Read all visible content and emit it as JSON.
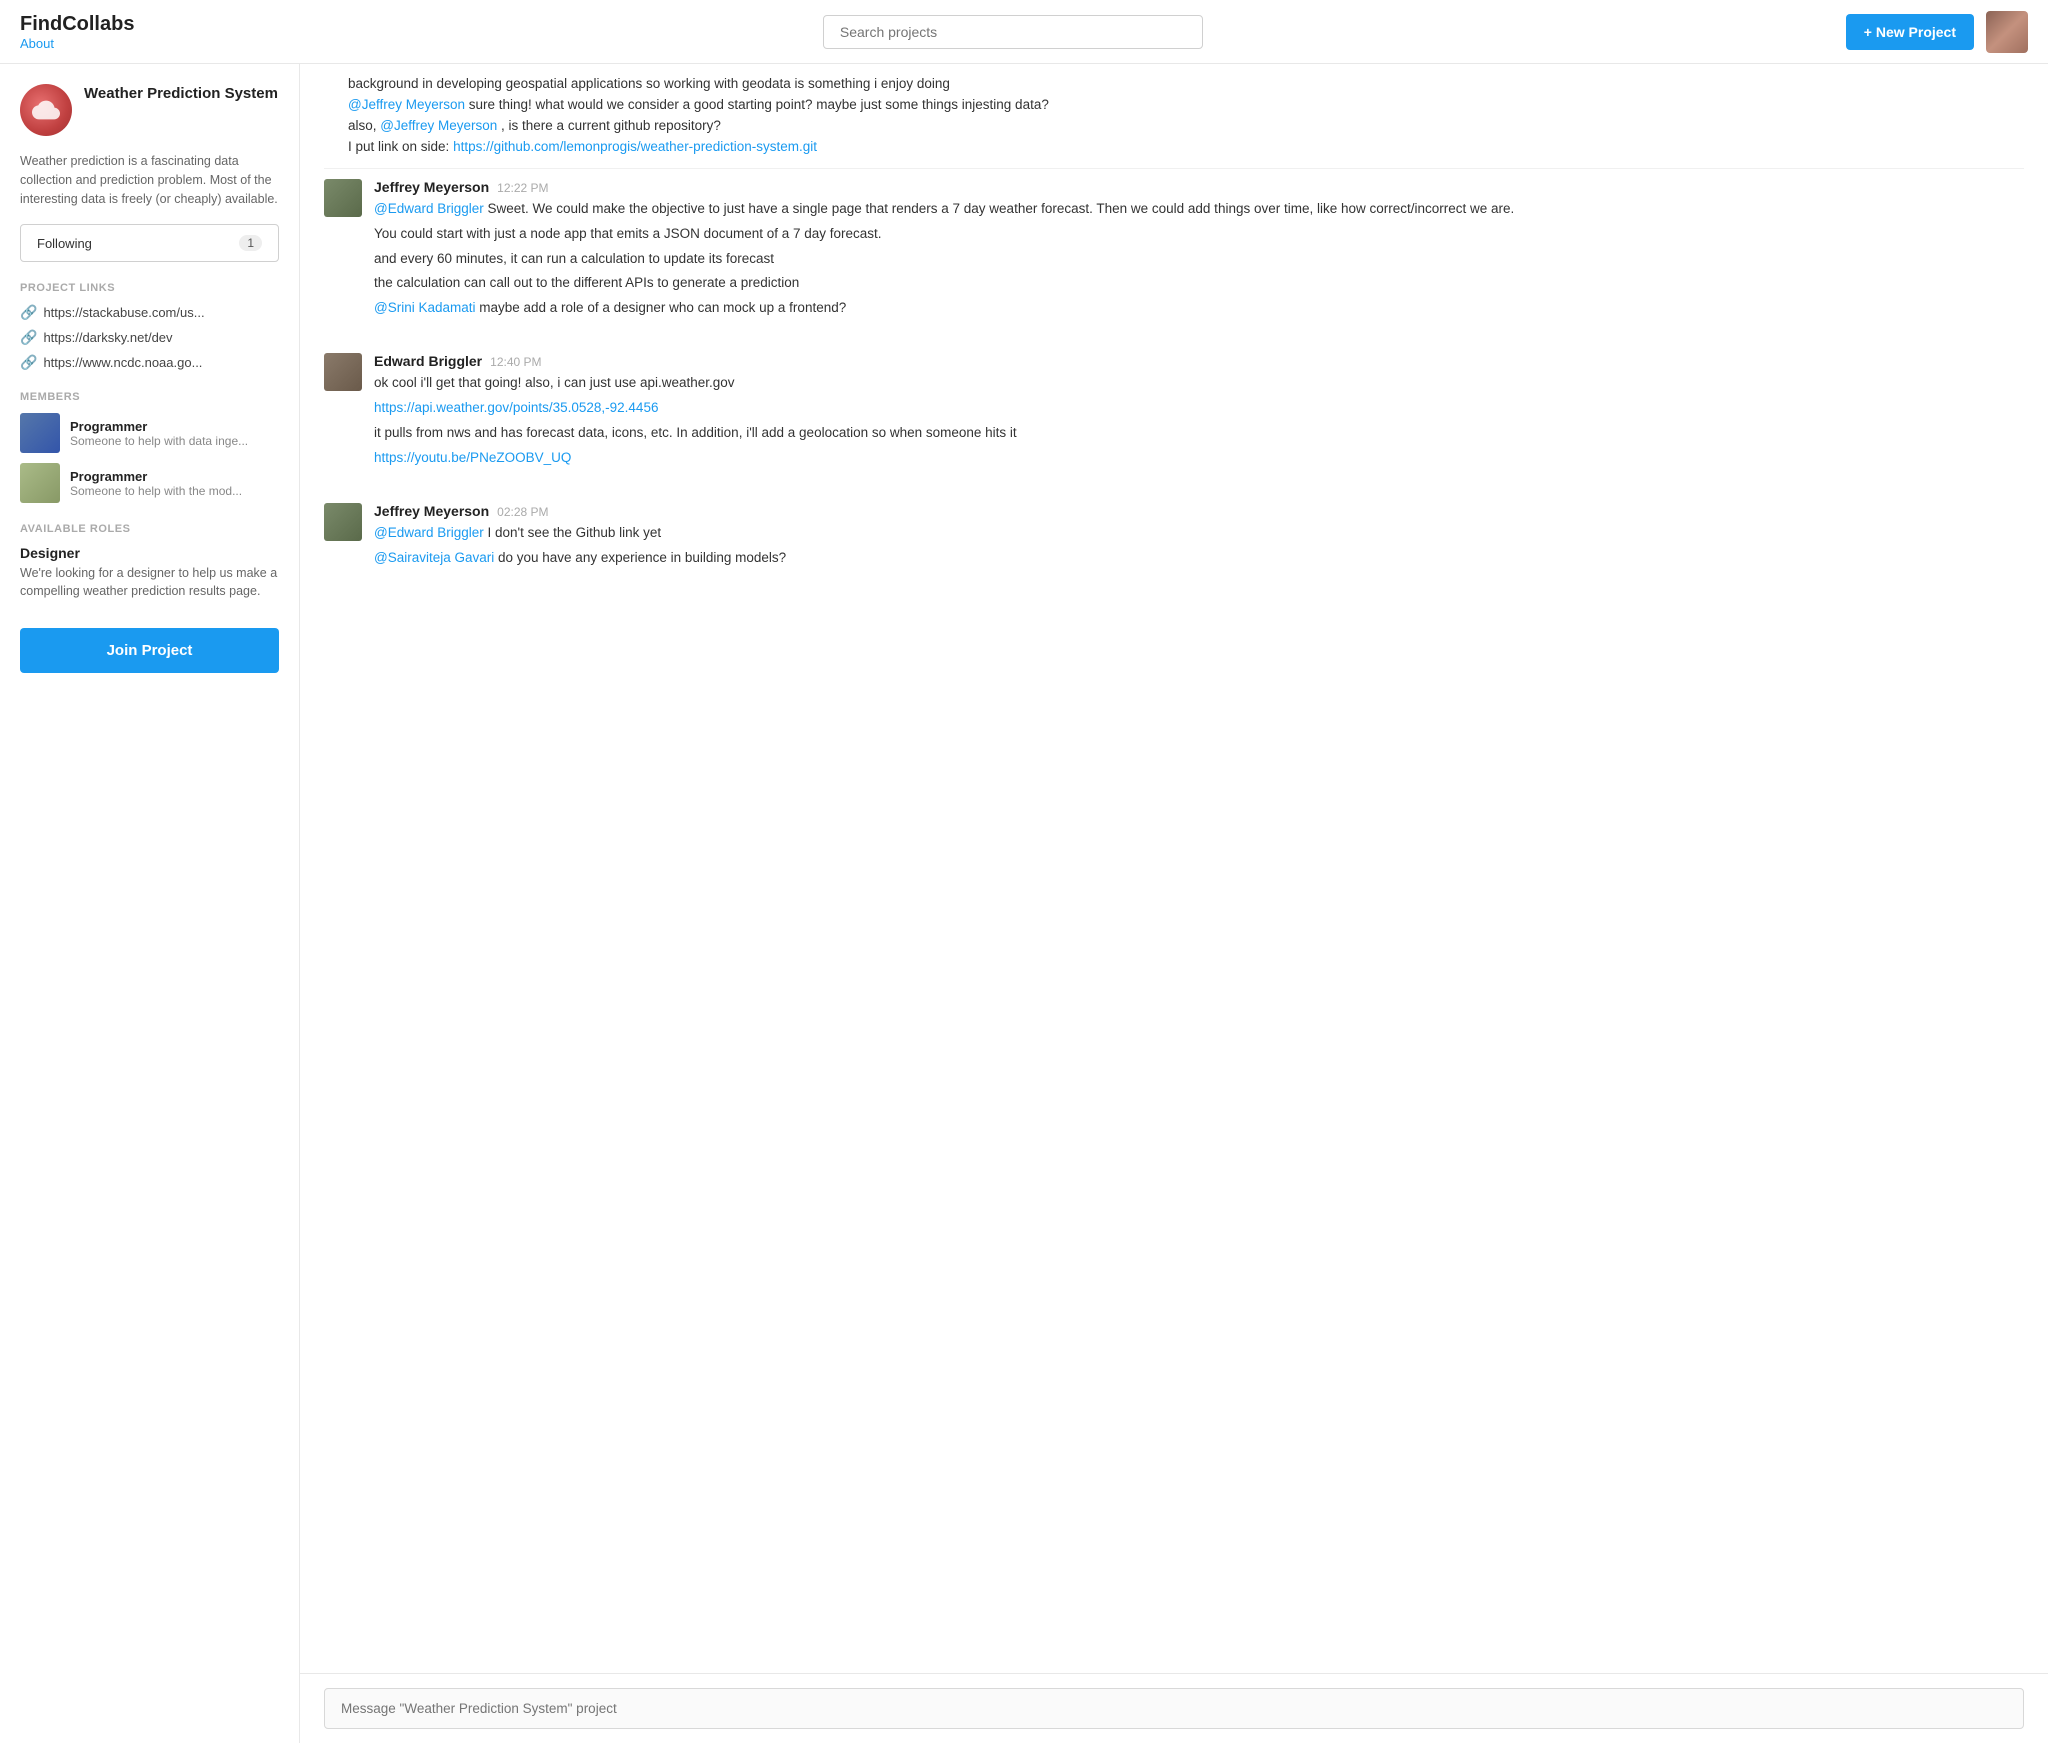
{
  "app": {
    "name": "FindCollabs",
    "about_label": "About"
  },
  "header": {
    "search_placeholder": "Search projects",
    "new_project_label": "+ New Project"
  },
  "sidebar": {
    "project_name": "Weather Prediction System",
    "project_description": "Weather prediction is a fascinating data collection and prediction problem. Most of the interesting data is freely (or cheaply) available.",
    "following_label": "Following",
    "following_count": "1",
    "project_links_label": "PROJECT LINKS",
    "links": [
      {
        "url": "https://stackabuse.com/us..."
      },
      {
        "url": "https://darksky.net/dev"
      },
      {
        "url": "https://www.ncdc.noaa.go..."
      }
    ],
    "members_label": "MEMBERS",
    "members": [
      {
        "role": "Programmer",
        "desc": "Someone to help with data inge..."
      },
      {
        "role": "Programmer",
        "desc": "Someone to help with the mod..."
      }
    ],
    "available_roles_label": "AVAILABLE ROLES",
    "roles": [
      {
        "title": "Designer",
        "desc": "We're looking for a designer to help us make a compelling weather prediction results page."
      }
    ],
    "join_label": "Join Project"
  },
  "chat": {
    "partial_messages": [
      "background in developing geospatial applications so working with geodata is something i enjoy doing",
      "@Jeffrey Meyerson sure thing! what would we consider a good starting point? maybe just some things injesting data?",
      "also, @Jeffrey Meyerson , is there a current github repository?",
      "I put link on side: https://github.com/lemonprogis/weather-prediction-system.git"
    ],
    "messages": [
      {
        "id": "msg1",
        "author": "Jeffrey Meyerson",
        "time": "12:22 PM",
        "avatar_class": "msg-avatar-jeffrey",
        "paragraphs": [
          "@Edward Briggler Sweet. We could make the objective to just have a single page that renders a 7 day weather forecast. Then we could add things over time, like how correct/incorrect we are.",
          "You could start with just a node app that emits a JSON document of a 7 day forecast.",
          "and every 60 minutes, it can run a calculation to update its forecast",
          "the calculation can call out to the different APIs to generate a prediction",
          "@Srini Kadamati maybe add a role of a designer who can mock up a frontend?"
        ],
        "mentions": [
          "@Edward Briggler",
          "@Srini Kadamati"
        ]
      },
      {
        "id": "msg2",
        "author": "Edward Briggler",
        "time": "12:40 PM",
        "avatar_class": "msg-avatar-edward",
        "paragraphs": [
          "ok cool i'll get that going! also, i can just use api.weather.gov",
          "https://api.weather.gov/points/35.0528,-92.4456",
          "it pulls from nws and has forecast data, icons, etc. In addition, i'll add a geolocation so when someone hits it",
          "https://youtu.be/PNeZOOBV_UQ"
        ],
        "mentions": []
      },
      {
        "id": "msg3",
        "author": "Jeffrey Meyerson",
        "time": "02:28 PM",
        "avatar_class": "msg-avatar-jeffrey",
        "paragraphs": [
          "@Edward Briggler I don't see the Github link yet",
          "@Sairaviteja Gavari do you have any experience in building models?"
        ],
        "mentions": [
          "@Edward Briggler",
          "@Sairaviteja Gavari"
        ]
      }
    ],
    "input_placeholder": "Message \"Weather Prediction System\" project"
  }
}
